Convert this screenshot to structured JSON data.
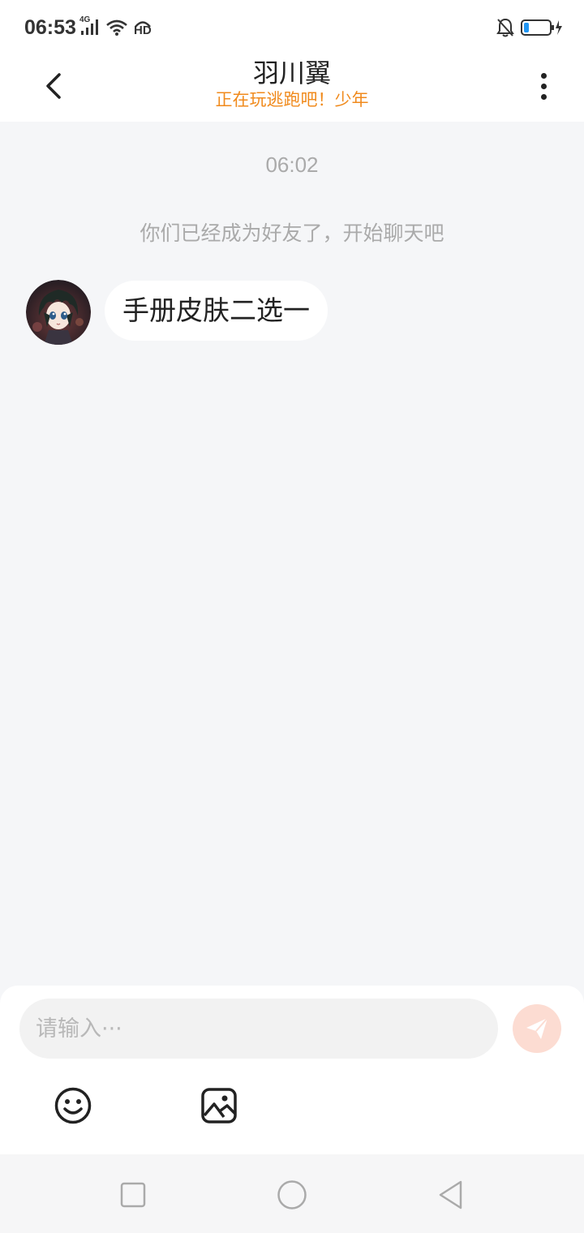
{
  "status_bar": {
    "time": "06:53",
    "network": "4G",
    "hd": "HD",
    "battery_color": "#2196f3"
  },
  "header": {
    "title": "羽川翼",
    "subtitle": "正在玩逃跑吧！少年"
  },
  "chat": {
    "timestamp": "06:02",
    "system_message": "你们已经成为好友了，开始聊天吧",
    "messages": [
      {
        "sender": "other",
        "text": "手册皮肤二选一"
      }
    ]
  },
  "composer": {
    "placeholder": "请输入···",
    "send_color": "#fcdcd2"
  },
  "colors": {
    "subtitle": "#f08a1c",
    "chat_bg": "#f5f6f8"
  }
}
